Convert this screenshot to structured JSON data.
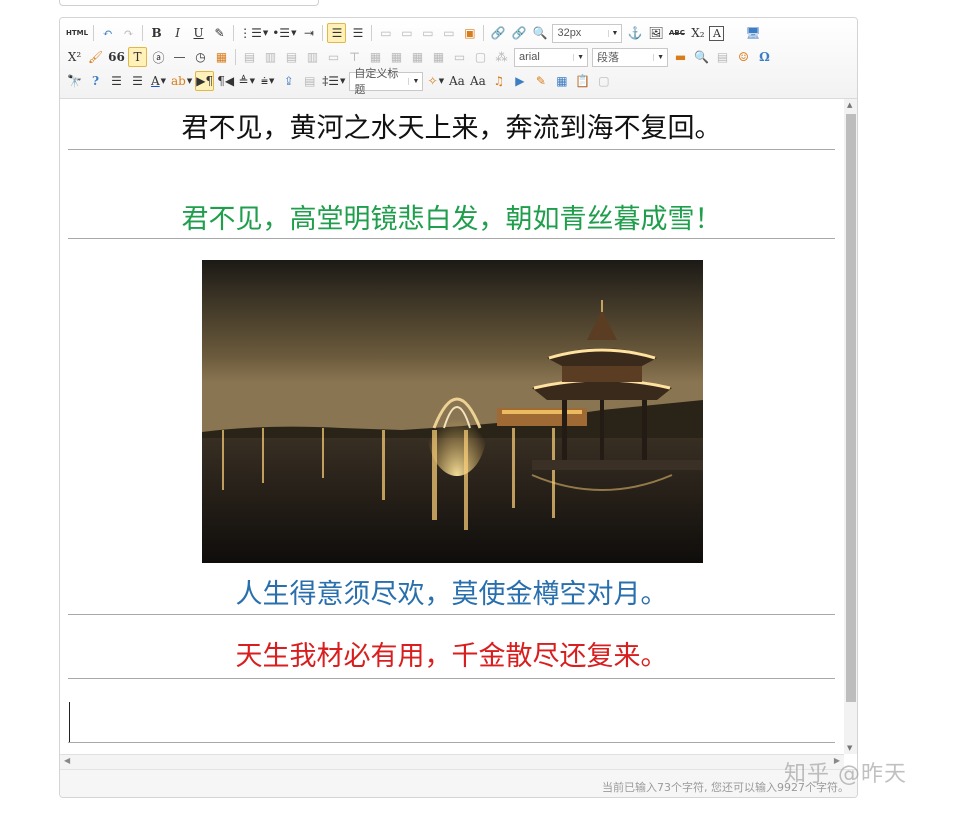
{
  "toolbar": {
    "row1": {
      "html": "HTML",
      "undo": "↶",
      "redo": "↷",
      "bold": "B",
      "italic": "I",
      "underline": "U",
      "eraser": "✎",
      "ordered_list": "⋮☰",
      "unordered_list": "•☰",
      "indent": "⇥",
      "align_left": "☰",
      "align_justify": "☰",
      "img_left": "▭",
      "img_center": "▭",
      "img_right": "▭",
      "img_none": "▭",
      "insert_image": "▣",
      "link": "🔗",
      "unlink": "🔗",
      "zoom": "🔍",
      "font_size": "32px",
      "anchor": "⚓",
      "image_manager": "🖼",
      "strikethrough": "ABC",
      "subscript": "X₂",
      "text_box": "A",
      "fullscreen": "🖥"
    },
    "row2": {
      "superscript": "X²",
      "format_brush": "🖌",
      "blockquote": "66",
      "paste_text": "T",
      "at": "ⓐ",
      "horizontal_rule": "—",
      "time": "◷",
      "date": "▦",
      "font_family": "arial",
      "paragraph": "段落",
      "snapshot": "▬",
      "search": "🔍",
      "template": "▤",
      "emotion": "☺",
      "special_char": "Ω"
    },
    "row3": {
      "find": "🔭",
      "help": "?",
      "indent_right": "☰",
      "justify": "☰",
      "font_color": "A",
      "background_color": "ab",
      "ltr": "▶¶",
      "rtl": "¶◀",
      "row_spacing_top": "≜",
      "row_spacing_bottom": "⩧",
      "upload": "⇪",
      "line_height": "‡☰",
      "custom_style": "自定义标题",
      "clear_doc": "✧",
      "case_upper": "Aa",
      "case_lower": "Aa",
      "music": "♫",
      "video": "▶",
      "wordimage": "✎",
      "table": "▦",
      "paste": "📋",
      "drafts": "▢"
    }
  },
  "content": {
    "line1": "君不见，黄河之水天上来，奔流到海不复回。",
    "line2": "君不见，高堂明镜悲白发，朝如青丝暮成雪！",
    "line3": "人生得意须尽欢，莫使金樽空对月。",
    "line4": "天生我材必有用，千金散尽还复来。"
  },
  "colors": {
    "line1": "#111111",
    "line2": "#1f9e4c",
    "line3": "#2a6fad",
    "line4": "#d81e1e"
  },
  "status": {
    "word_count": "当前已输入73个字符, 您还可以输入9927个字符。"
  },
  "watermark": "知乎 @昨天"
}
